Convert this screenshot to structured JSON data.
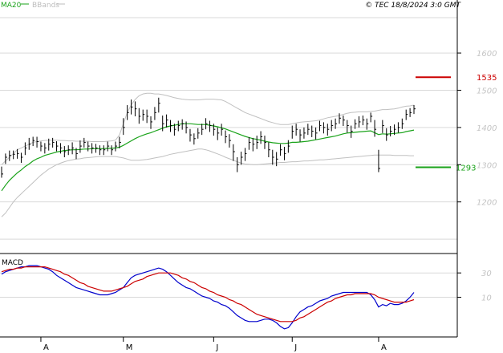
{
  "header": {
    "legend_ma": "MA20",
    "legend_bb": "BBands",
    "copyright": "© TEC 18/8/2024 3:0 GMT"
  },
  "colors": {
    "price_bar": "#000000",
    "ma20": "#1aa31a",
    "bbands": "#c0c0c0",
    "grid": "#d9d9d9",
    "resistance": "#cc0000",
    "support": "#1aa31a",
    "macd": "#0000cc",
    "signal": "#cc0000"
  },
  "chart_data": [
    {
      "type": "ohlc",
      "panel": "price",
      "ylim": [
        1070,
        1695
      ],
      "y_ticks": [
        1200,
        1300,
        1400,
        1500,
        1600
      ],
      "y_tick_labels": [
        "1200",
        "1300",
        "1400",
        "1500",
        "1600"
      ],
      "x_ticks": [
        {
          "label": "A",
          "index": 10
        },
        {
          "label": "M",
          "index": 31
        },
        {
          "label": "J",
          "index": 54
        },
        {
          "label": "J",
          "index": 74
        },
        {
          "label": "A",
          "index": 96
        }
      ],
      "levels": [
        {
          "name": "resistance",
          "value": 1535,
          "label": "1535"
        },
        {
          "name": "support",
          "value": 1293,
          "label": "1293"
        }
      ],
      "close": [
        1275,
        1320,
        1325,
        1328,
        1330,
        1320,
        1345,
        1355,
        1365,
        1362,
        1350,
        1345,
        1355,
        1360,
        1350,
        1345,
        1335,
        1340,
        1345,
        1330,
        1350,
        1360,
        1350,
        1345,
        1345,
        1340,
        1340,
        1350,
        1340,
        1350,
        1360,
        1400,
        1440,
        1455,
        1450,
        1430,
        1435,
        1430,
        1415,
        1440,
        1465,
        1410,
        1420,
        1405,
        1395,
        1405,
        1410,
        1400,
        1380,
        1370,
        1385,
        1395,
        1410,
        1405,
        1395,
        1385,
        1395,
        1375,
        1365,
        1335,
        1300,
        1320,
        1330,
        1360,
        1355,
        1360,
        1375,
        1360,
        1340,
        1320,
        1315,
        1340,
        1330,
        1350,
        1390,
        1395,
        1380,
        1385,
        1395,
        1390,
        1385,
        1405,
        1400,
        1395,
        1405,
        1410,
        1425,
        1420,
        1405,
        1390,
        1410,
        1415,
        1420,
        1410,
        1430,
        1395,
        1290,
        1405,
        1380,
        1390,
        1395,
        1400,
        1410,
        1435,
        1440,
        1450
      ],
      "high": [
        1295,
        1330,
        1338,
        1338,
        1342,
        1332,
        1360,
        1372,
        1375,
        1375,
        1362,
        1358,
        1370,
        1372,
        1363,
        1358,
        1350,
        1352,
        1360,
        1345,
        1365,
        1372,
        1362,
        1358,
        1356,
        1352,
        1352,
        1362,
        1352,
        1362,
        1375,
        1425,
        1460,
        1475,
        1470,
        1452,
        1448,
        1448,
        1430,
        1455,
        1480,
        1432,
        1435,
        1420,
        1410,
        1418,
        1422,
        1416,
        1396,
        1384,
        1398,
        1410,
        1425,
        1418,
        1410,
        1400,
        1410,
        1392,
        1382,
        1355,
        1320,
        1335,
        1345,
        1374,
        1372,
        1378,
        1390,
        1378,
        1360,
        1340,
        1334,
        1355,
        1348,
        1366,
        1405,
        1410,
        1395,
        1400,
        1410,
        1405,
        1400,
        1418,
        1414,
        1410,
        1420,
        1424,
        1438,
        1432,
        1420,
        1405,
        1422,
        1430,
        1432,
        1424,
        1440,
        1420,
        1340,
        1420,
        1398,
        1404,
        1408,
        1414,
        1424,
        1448,
        1452,
        1460
      ],
      "low": [
        1265,
        1302,
        1310,
        1315,
        1316,
        1305,
        1326,
        1340,
        1350,
        1346,
        1336,
        1330,
        1338,
        1346,
        1336,
        1330,
        1320,
        1326,
        1328,
        1315,
        1332,
        1346,
        1336,
        1330,
        1332,
        1326,
        1326,
        1336,
        1326,
        1336,
        1344,
        1380,
        1420,
        1435,
        1430,
        1410,
        1418,
        1412,
        1396,
        1420,
        1440,
        1390,
        1400,
        1388,
        1378,
        1390,
        1394,
        1384,
        1362,
        1354,
        1370,
        1380,
        1395,
        1388,
        1378,
        1366,
        1378,
        1358,
        1346,
        1310,
        1280,
        1300,
        1310,
        1340,
        1336,
        1342,
        1356,
        1342,
        1320,
        1300,
        1296,
        1324,
        1312,
        1332,
        1370,
        1378,
        1362,
        1370,
        1380,
        1374,
        1368,
        1390,
        1384,
        1378,
        1390,
        1396,
        1410,
        1404,
        1386,
        1372,
        1396,
        1400,
        1406,
        1394,
        1414,
        1375,
        1280,
        1385,
        1364,
        1376,
        1380,
        1386,
        1396,
        1420,
        1428,
        1436
      ],
      "ma20": [
        1230,
        1245,
        1258,
        1268,
        1278,
        1286,
        1295,
        1302,
        1310,
        1316,
        1320,
        1325,
        1328,
        1331,
        1334,
        1336,
        1338,
        1339,
        1340,
        1340,
        1341,
        1342,
        1342,
        1343,
        1343,
        1343,
        1343,
        1344,
        1344,
        1345,
        1347,
        1352,
        1358,
        1364,
        1370,
        1375,
        1379,
        1383,
        1386,
        1390,
        1394,
        1398,
        1402,
        1404,
        1406,
        1408,
        1410,
        1410,
        1410,
        1409,
        1408,
        1408,
        1408,
        1406,
        1404,
        1402,
        1399,
        1396,
        1392,
        1388,
        1384,
        1380,
        1376,
        1373,
        1370,
        1368,
        1366,
        1363,
        1361,
        1359,
        1358,
        1357,
        1357,
        1358,
        1360,
        1360,
        1361,
        1362,
        1363,
        1365,
        1367,
        1369,
        1371,
        1373,
        1375,
        1377,
        1380,
        1383,
        1385,
        1386,
        1387,
        1388,
        1389,
        1390,
        1391,
        1386,
        1381,
        1383,
        1382,
        1383,
        1384,
        1385,
        1386,
        1389,
        1391,
        1393
      ],
      "bb_upper": [
        1300,
        1310,
        1320,
        1330,
        1340,
        1345,
        1350,
        1355,
        1360,
        1362,
        1364,
        1365,
        1366,
        1366,
        1366,
        1365,
        1365,
        1364,
        1364,
        1363,
        1363,
        1363,
        1363,
        1362,
        1362,
        1362,
        1362,
        1363,
        1364,
        1366,
        1380,
        1410,
        1440,
        1460,
        1475,
        1485,
        1490,
        1492,
        1492,
        1490,
        1490,
        1488,
        1486,
        1483,
        1480,
        1478,
        1476,
        1475,
        1474,
        1474,
        1474,
        1475,
        1476,
        1476,
        1476,
        1475,
        1474,
        1470,
        1464,
        1458,
        1452,
        1446,
        1440,
        1436,
        1432,
        1428,
        1424,
        1420,
        1416,
        1413,
        1410,
        1408,
        1408,
        1408,
        1410,
        1412,
        1414,
        1415,
        1416,
        1417,
        1418,
        1420,
        1423,
        1426,
        1428,
        1430,
        1432,
        1435,
        1438,
        1440,
        1441,
        1442,
        1442,
        1442,
        1443,
        1444,
        1446,
        1448,
        1448,
        1449,
        1450,
        1452,
        1455,
        1457,
        1458,
        1460
      ],
      "bb_lower": [
        1160,
        1170,
        1185,
        1200,
        1212,
        1222,
        1232,
        1242,
        1252,
        1262,
        1272,
        1280,
        1288,
        1294,
        1300,
        1304,
        1308,
        1311,
        1313,
        1315,
        1316,
        1318,
        1319,
        1320,
        1321,
        1322,
        1322,
        1322,
        1322,
        1322,
        1320,
        1318,
        1315,
        1312,
        1312,
        1312,
        1313,
        1314,
        1316,
        1318,
        1320,
        1322,
        1325,
        1328,
        1330,
        1332,
        1334,
        1336,
        1338,
        1340,
        1342,
        1342,
        1340,
        1337,
        1333,
        1329,
        1325,
        1320,
        1316,
        1312,
        1308,
        1304,
        1302,
        1301,
        1300,
        1300,
        1301,
        1302,
        1303,
        1304,
        1305,
        1306,
        1306,
        1307,
        1308,
        1308,
        1309,
        1310,
        1310,
        1311,
        1312,
        1313,
        1313,
        1314,
        1315,
        1316,
        1317,
        1318,
        1319,
        1320,
        1321,
        1322,
        1323,
        1324,
        1325,
        1326,
        1326,
        1326,
        1326,
        1326,
        1325,
        1325,
        1325,
        1325,
        1324,
        1324
      ]
    },
    {
      "type": "line",
      "panel": "macd",
      "title": "MACD",
      "ylim": [
        -20,
        42
      ],
      "y_ticks": [
        10,
        30
      ],
      "y_tick_labels": [
        "10",
        "30"
      ],
      "series": [
        {
          "name": "MACD",
          "color": "#0000cc",
          "values": [
            29,
            31,
            32,
            33,
            34,
            35,
            35,
            36,
            36,
            36,
            35,
            34,
            33,
            31,
            28,
            26,
            24,
            22,
            20,
            18,
            17,
            16,
            15,
            14,
            13,
            12,
            12,
            12,
            13,
            14,
            16,
            18,
            22,
            26,
            28,
            29,
            30,
            31,
            32,
            33,
            34,
            33,
            31,
            28,
            25,
            22,
            20,
            18,
            17,
            15,
            13,
            11,
            10,
            9,
            7,
            6,
            4,
            3,
            1,
            -2,
            -5,
            -7,
            -9,
            -10,
            -10,
            -10,
            -9,
            -8,
            -8,
            -9,
            -11,
            -14,
            -16,
            -15,
            -11,
            -6,
            -2,
            0,
            2,
            3,
            5,
            7,
            8,
            9,
            11,
            12,
            13,
            14,
            14,
            14,
            14,
            14,
            14,
            14,
            12,
            8,
            2,
            4,
            3,
            5,
            4,
            4,
            5,
            7,
            10,
            14
          ]
        },
        {
          "name": "Signal",
          "color": "#cc0000",
          "values": [
            31,
            32,
            33,
            33,
            34,
            34,
            35,
            35,
            35,
            35,
            35,
            35,
            34,
            33,
            32,
            31,
            29,
            28,
            26,
            24,
            22,
            21,
            19,
            18,
            17,
            16,
            15,
            15,
            15,
            16,
            17,
            18,
            19,
            21,
            23,
            24,
            25,
            27,
            28,
            29,
            30,
            30,
            30,
            30,
            29,
            28,
            26,
            25,
            23,
            22,
            20,
            18,
            17,
            15,
            14,
            12,
            11,
            10,
            8,
            7,
            5,
            4,
            2,
            0,
            -2,
            -4,
            -5,
            -6,
            -7,
            -8,
            -9,
            -10,
            -10,
            -10,
            -10,
            -9,
            -7,
            -6,
            -4,
            -2,
            0,
            2,
            4,
            6,
            7,
            9,
            10,
            11,
            12,
            12,
            13,
            13,
            13,
            13,
            13,
            12,
            10,
            9,
            8,
            7,
            6,
            6,
            6,
            6,
            7,
            8
          ]
        }
      ]
    }
  ]
}
